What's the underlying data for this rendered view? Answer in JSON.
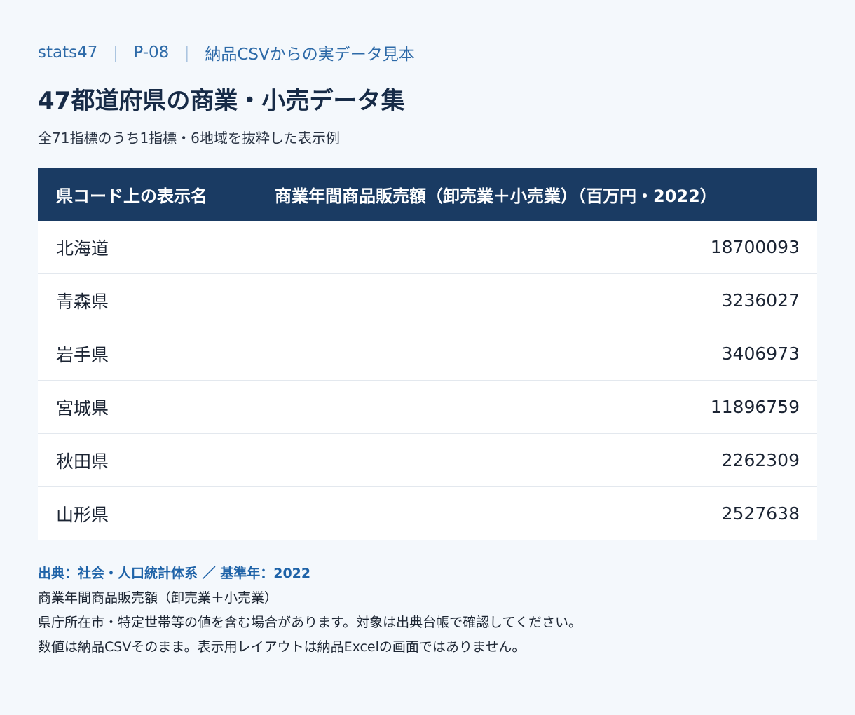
{
  "breadcrumb": {
    "site": "stats47",
    "code": "P-08",
    "label": "納品CSVからの実データ見本",
    "separator": "｜"
  },
  "title": "47都道府県の商業・小売データ集",
  "subtitle": "全71指標のうち1指標・6地域を抜粋した表示例",
  "table": {
    "headers": {
      "name": "県コード上の表示名",
      "value": "商業年間商品販売額（卸売業＋小売業）（百万円・2022）"
    },
    "rows": [
      {
        "name": "北海道",
        "value": "18700093"
      },
      {
        "name": "青森県",
        "value": "3236027"
      },
      {
        "name": "岩手県",
        "value": "3406973"
      },
      {
        "name": "宮城県",
        "value": "11896759"
      },
      {
        "name": "秋田県",
        "value": "2262309"
      },
      {
        "name": "山形県",
        "value": "2527638"
      }
    ]
  },
  "footer": {
    "source": "出典：社会・人口統計体系 ／ 基準年：2022",
    "line1": "商業年間商品販売額（卸売業＋小売業）",
    "line2": "県庁所在市・特定世帯等の値を含む場合があります。対象は出典台帳で確認してください。",
    "line3": "数値は納品CSVそのまま。表示用レイアウトは納品Excelの画面ではありません。"
  }
}
